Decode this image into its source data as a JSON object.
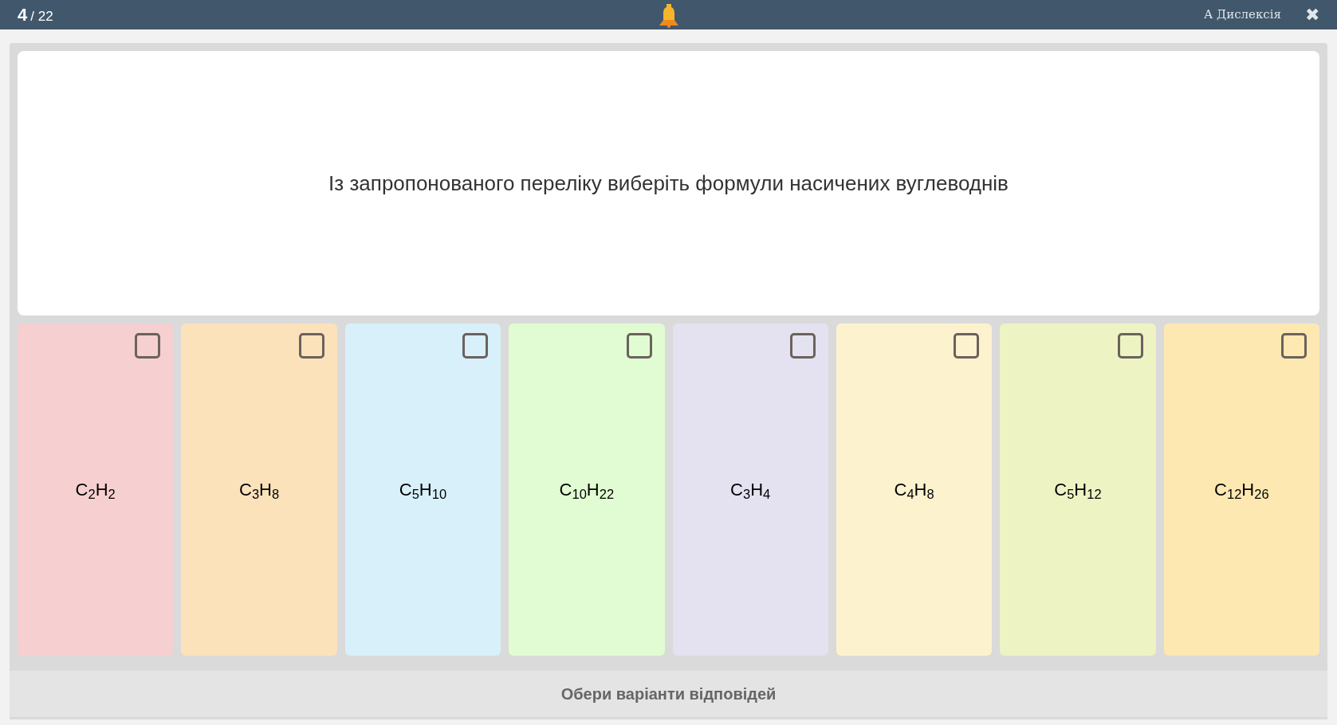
{
  "top_bar": {
    "current": "4",
    "total": "/ 22",
    "dyslexia_label": "A Дислексія",
    "close": "✖"
  },
  "question": "Із запропонованого переліку виберіть формули насичених вуглеводнів",
  "options": [
    {
      "formula": "C$_{2}$H$_{2}$",
      "color": "#f6cfd1",
      "checked": false
    },
    {
      "formula": "C$_{3}$H$_{8}$",
      "color": "#fbe2bb",
      "checked": false
    },
    {
      "formula": "C$_{5}$H$_{10}$",
      "color": "#d8f0fa",
      "checked": false
    },
    {
      "formula": "C$_{10}$H$_{22}$",
      "color": "#e1fcd2",
      "checked": false
    },
    {
      "formula": "C$_{3}$H$_{4}$",
      "color": "#e4e2f0",
      "checked": false
    },
    {
      "formula": "C$_{4}$H$_{8}$",
      "color": "#fdf2ce",
      "checked": false
    },
    {
      "formula": "C$_{5}$H$_{12}$",
      "color": "#eef3c4",
      "checked": false
    },
    {
      "formula": "C$_{12}$H$_{26}$",
      "color": "#fde8b2",
      "checked": false
    }
  ],
  "submit": "Обери варіанти відповідей"
}
